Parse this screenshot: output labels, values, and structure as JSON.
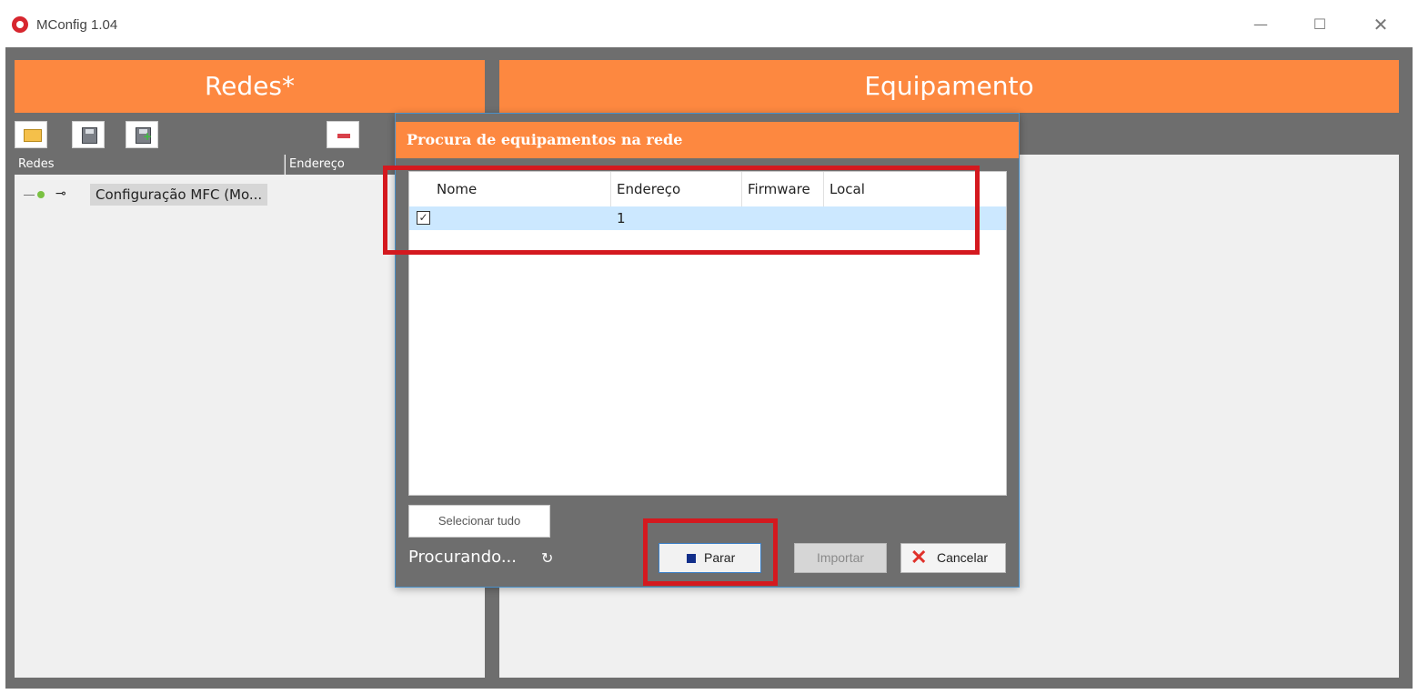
{
  "window": {
    "title": "MConfig 1.04",
    "controls": {
      "minimize": "—",
      "maximize": "☐",
      "close": "✕"
    }
  },
  "left_panel": {
    "header": "Redes*",
    "toolbar": [
      "open-folder",
      "save",
      "save-as",
      "remove"
    ],
    "columns": [
      "Redes",
      "Endereço"
    ],
    "tree_items": [
      {
        "label": "Configuração MFC (Mo..."
      }
    ]
  },
  "right_panel": {
    "header": "Equipamento"
  },
  "dialog": {
    "title": "Procura de equipamentos na rede",
    "columns": {
      "nome": "Nome",
      "endereco": "Endereço",
      "firmware": "Firmware",
      "local": "Local"
    },
    "rows": [
      {
        "checked": true,
        "nome": "",
        "endereco": "1",
        "firmware": "",
        "local": ""
      }
    ],
    "select_all_label": "Selecionar tudo",
    "status": "Procurando...",
    "buttons": {
      "stop": "Parar",
      "import": "Importar",
      "cancel": "Cancelar"
    }
  },
  "colors": {
    "accent": "#fd8840",
    "highlight": "#d4191f",
    "selection": "#cce8ff",
    "frame": "#6e6e6e"
  }
}
